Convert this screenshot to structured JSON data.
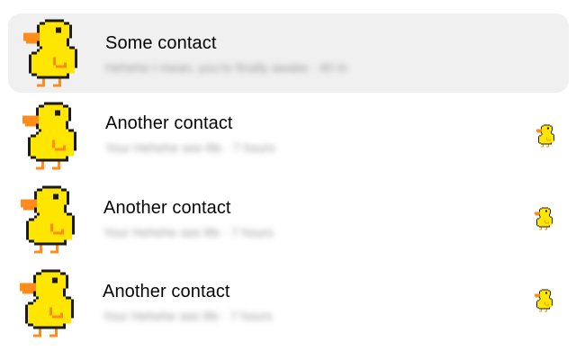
{
  "conversations": [
    {
      "name": "Some contact",
      "preview": "Hehehe I mean, you're finally awake · 40 m",
      "selected": true,
      "seen_icon": null,
      "avatar_icon": "duck-icon"
    },
    {
      "name": "Another contact",
      "preview": "Your Hehehe see life · 7 hours",
      "selected": false,
      "seen_icon": "duck-seen-icon",
      "avatar_icon": "duck-icon"
    },
    {
      "name": "Another contact",
      "preview": "Your Hehehe see life · 7 hours",
      "selected": false,
      "seen_icon": "duck-seen-icon",
      "avatar_icon": "duck-icon"
    },
    {
      "name": "Another contact",
      "preview": "Your Hehehe see life · 7 hours",
      "selected": false,
      "seen_icon": "duck-seen-icon",
      "avatar_icon": "duck-icon"
    }
  ],
  "colors": {
    "selected_background": "#f0f0f0",
    "duck_yellow": "#ffe600",
    "duck_orange": "#ff8c1a",
    "duck_outline": "#1a1a1a"
  }
}
